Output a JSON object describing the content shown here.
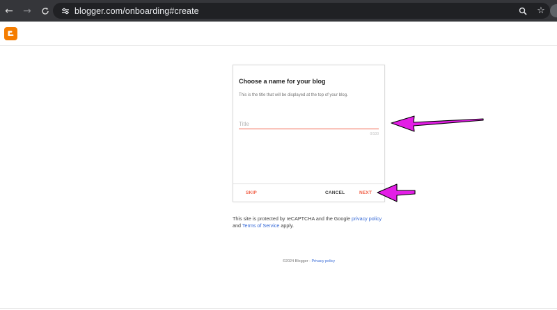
{
  "browser": {
    "url": "blogger.com/onboarding#create",
    "icons": {
      "back": "arrow-back-icon",
      "forward": "arrow-forward-icon",
      "reload": "reload-icon",
      "site_info": "tune-icon",
      "zoom": "zoom-icon",
      "bookmark": "star-icon"
    }
  },
  "header": {
    "logo": "blogger-logo",
    "logo_color": "#f57d00"
  },
  "dialog": {
    "title": "Choose a name for your blog",
    "subtitle": "This is the title that will be displayed at the top of your blog.",
    "input": {
      "placeholder": "Title",
      "value": "",
      "counter": "0/100"
    },
    "buttons": {
      "skip": "SKIP",
      "cancel": "CANCEL",
      "next": "NEXT"
    },
    "accent_color": "#f16148"
  },
  "notice": {
    "text_before": "This site is protected by reCAPTCHA and the Google ",
    "privacy_link": "privacy policy",
    "text_and": " and ",
    "terms_link": "Terms of Service",
    "text_after": " apply."
  },
  "footer": {
    "copyright": "©2024 Blogger - ",
    "privacy_link": "Privacy policy"
  },
  "annotations": {
    "arrow_color": "#e31ee6"
  }
}
